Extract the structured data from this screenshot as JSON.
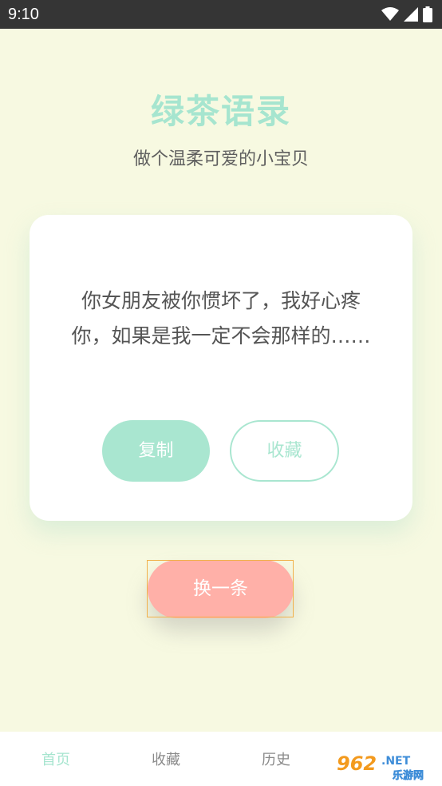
{
  "status_bar": {
    "time": "9:10",
    "icons": [
      "wifi-icon",
      "cellular-signal-icon",
      "battery-icon"
    ]
  },
  "header": {
    "title": "绿茶语录",
    "subtitle": "做个温柔可爱的小宝贝"
  },
  "quote_card": {
    "text": "你女朋友被你惯坏了，我好心疼你，如果是我一定不会那样的……",
    "copy_label": "复制",
    "favorite_label": "收藏"
  },
  "next_button": {
    "label": "换一条"
  },
  "bottom_nav": {
    "items": [
      {
        "label": "首页",
        "active": true
      },
      {
        "label": "收藏",
        "active": false
      },
      {
        "label": "历史",
        "active": false
      },
      {
        "label": "",
        "active": false
      }
    ]
  },
  "watermark": {
    "brand": "962.NET",
    "brand_sub": "乐游网"
  },
  "colors": {
    "background": "#f7f9e1",
    "accent_green": "#a6e5cf",
    "accent_pink": "#ffb0a8",
    "status_bar": "#353535"
  }
}
